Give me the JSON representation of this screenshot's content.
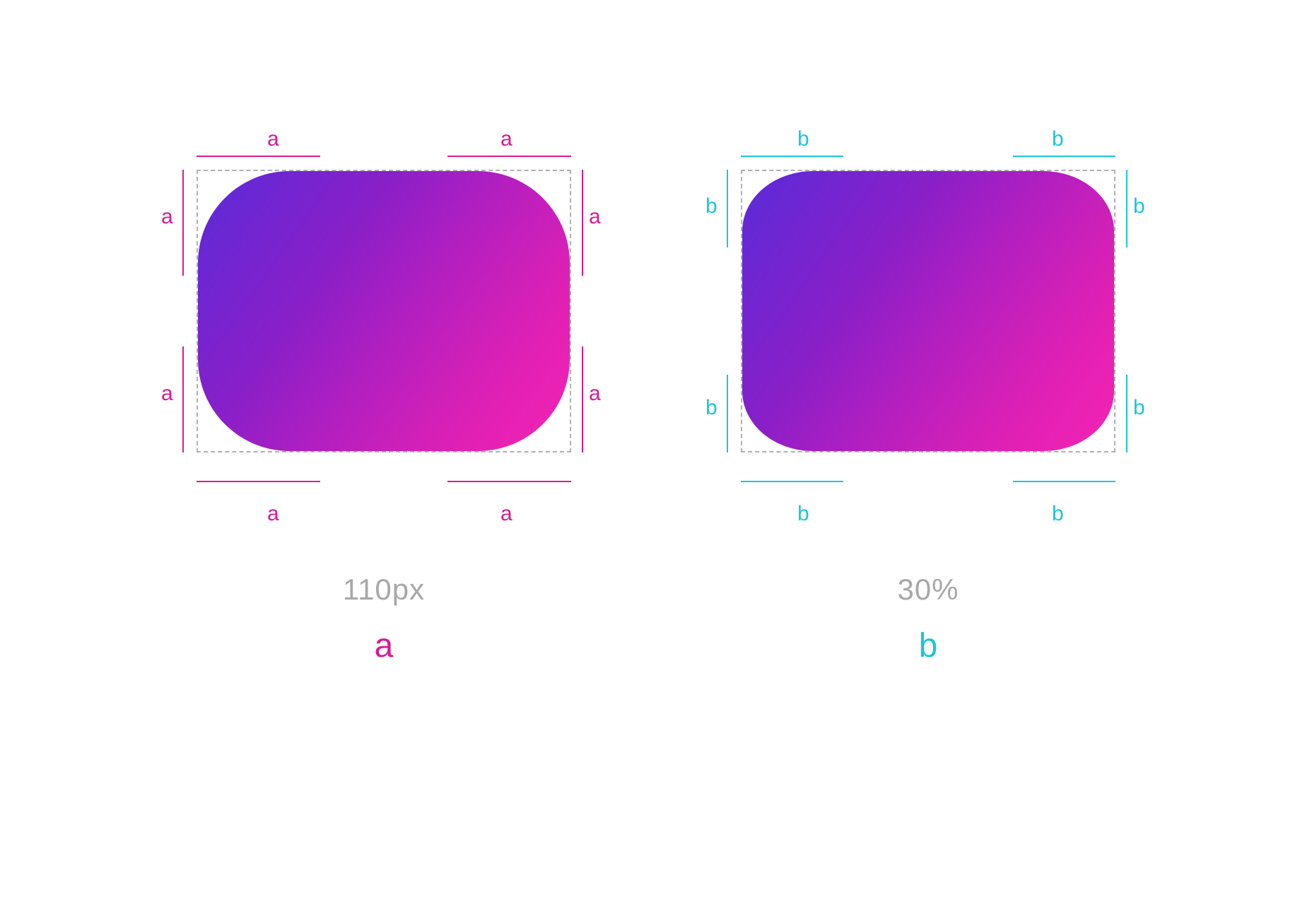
{
  "panels": [
    {
      "key": "a",
      "dimLabel": "a",
      "captionValue": "110px",
      "captionKey": "a",
      "color": "#d81b93"
    },
    {
      "key": "b",
      "dimLabel": "b",
      "captionValue": "30%",
      "captionKey": "b",
      "color": "#1bc6d8"
    }
  ]
}
